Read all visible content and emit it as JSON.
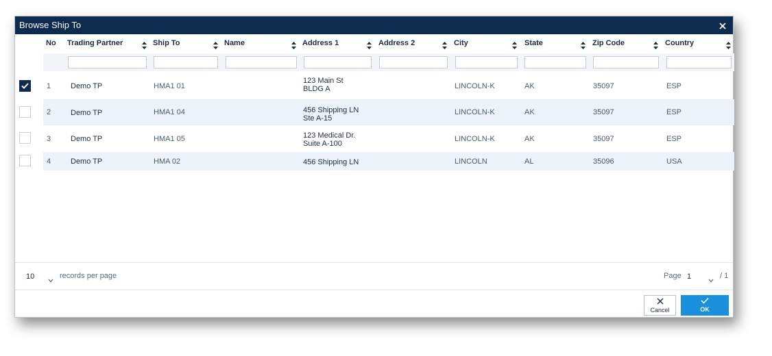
{
  "dialog": {
    "title": "Browse Ship To"
  },
  "columns": [
    {
      "key": "no",
      "label": "No",
      "sortable": false
    },
    {
      "key": "trading_partner",
      "label": "Trading Partner",
      "sortable": true
    },
    {
      "key": "ship_to",
      "label": "Ship To",
      "sortable": true
    },
    {
      "key": "name",
      "label": "Name",
      "sortable": true
    },
    {
      "key": "address1",
      "label": "Address 1",
      "sortable": true
    },
    {
      "key": "address2",
      "label": "Address 2",
      "sortable": true
    },
    {
      "key": "city",
      "label": "City",
      "sortable": true
    },
    {
      "key": "state",
      "label": "State",
      "sortable": true
    },
    {
      "key": "zip",
      "label": "Zip Code",
      "sortable": true
    },
    {
      "key": "country",
      "label": "Country",
      "sortable": true
    }
  ],
  "filters": {
    "trading_partner": "",
    "ship_to": "",
    "name": "",
    "address1": "",
    "address2": "",
    "city": "",
    "state": "",
    "zip": "",
    "country": ""
  },
  "rows": [
    {
      "selected": true,
      "no": "1",
      "trading_partner": "Demo TP",
      "ship_to": "HMA1 01",
      "name": "",
      "address1_line1": "123 Main St",
      "address1_line2": "BLDG A",
      "address2": "",
      "city": "LINCOLN-K",
      "state": "AK",
      "zip": "35097",
      "country": "ESP"
    },
    {
      "selected": false,
      "no": "2",
      "trading_partner": "Demo TP",
      "ship_to": "HMA1 04",
      "name": "",
      "address1_line1": "456 Shipping LN",
      "address1_line2": "Ste A-15",
      "address2": "",
      "city": "LINCOLN-K",
      "state": "AK",
      "zip": "35097",
      "country": "ESP"
    },
    {
      "selected": false,
      "no": "3",
      "trading_partner": "Demo TP",
      "ship_to": "HMA1 05",
      "name": "",
      "address1_line1": "123 Medical Dr.",
      "address1_line2": "Suite A-100",
      "address2": "",
      "city": "LINCOLN-K",
      "state": "AK",
      "zip": "35097",
      "country": "ESP"
    },
    {
      "selected": false,
      "no": "4",
      "trading_partner": "Demo TP",
      "ship_to": "HMA 02",
      "name": "",
      "address1_line1": "456 Shipping LN",
      "address1_line2": "",
      "address2": "",
      "city": "LINCOLN",
      "state": "AL",
      "zip": "35096",
      "country": "USA"
    }
  ],
  "pager": {
    "page_size": "10",
    "records_per_page_label": "records per page",
    "page_label": "Page",
    "page_value": "1",
    "page_total": "/ 1"
  },
  "buttons": {
    "cancel_label": "Cancel",
    "ok_label": "OK"
  },
  "colors": {
    "titlebar": "#0d2a4f",
    "accent": "#1a8fde",
    "alt_row": "#edf3fa"
  },
  "icons": {
    "close": "close-icon",
    "sort": "sort-icon",
    "check": "check-icon",
    "chevron": "chevron-down-icon"
  }
}
